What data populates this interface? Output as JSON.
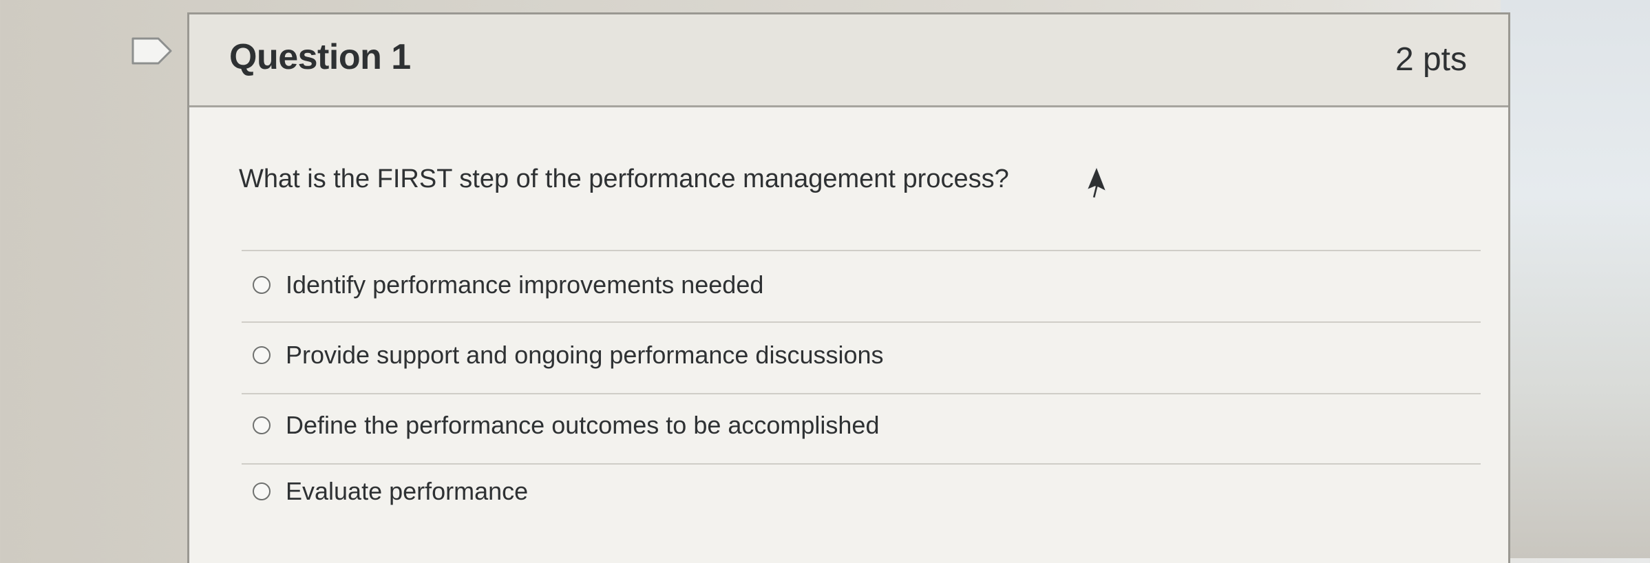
{
  "question": {
    "title": "Question 1",
    "points": "2 pts",
    "text": "What is the FIRST step of the performance management process?",
    "flag_icon": "flag-outline-icon",
    "answers": [
      {
        "label": "Identify performance improvements needed",
        "selected": false
      },
      {
        "label": "Provide support and ongoing performance discussions",
        "selected": false
      },
      {
        "label": "Define the performance outcomes to be accomplished",
        "selected": false
      },
      {
        "label": "Evaluate performance",
        "selected": false
      }
    ]
  },
  "colors": {
    "text": "#2e3133",
    "card_background": "#f3f2ee",
    "header_background": "#e6e4de",
    "border": "#9a9892"
  }
}
